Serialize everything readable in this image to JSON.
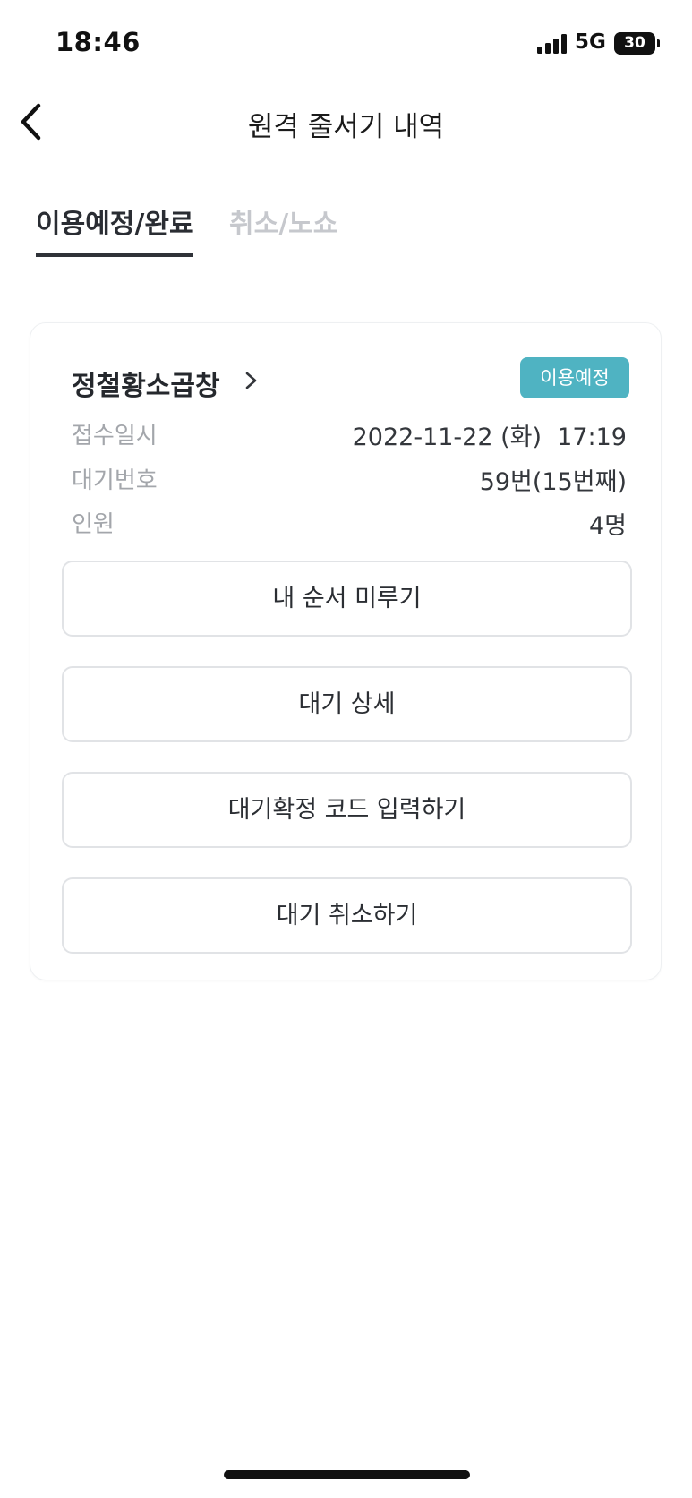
{
  "status_bar": {
    "time": "18:46",
    "network": "5G",
    "battery": "30",
    "icons": [
      "signal-icon",
      "battery-icon"
    ]
  },
  "header": {
    "title": "원격 줄서기 내역",
    "back_icon": "chevron-left-icon"
  },
  "tabs": [
    {
      "label": "이용예정/완료",
      "active": true
    },
    {
      "label": "취소/노쇼",
      "active": false
    }
  ],
  "reservation": {
    "store_name": "정철황소곱창",
    "store_link_icon": "chevron-right-icon",
    "status": "이용예정",
    "status_color": "#4fb3c2",
    "info": [
      {
        "label": "접수일시",
        "value": "2022-11-22 (화)  17:19"
      },
      {
        "label": "대기번호",
        "value": "59번(15번째)"
      },
      {
        "label": "인원",
        "value": "4명"
      }
    ],
    "actions": [
      {
        "label": "내 순서 미루기"
      },
      {
        "label": "대기 상세"
      },
      {
        "label": "대기확정 코드 입력하기"
      },
      {
        "label": "대기 취소하기"
      }
    ]
  }
}
